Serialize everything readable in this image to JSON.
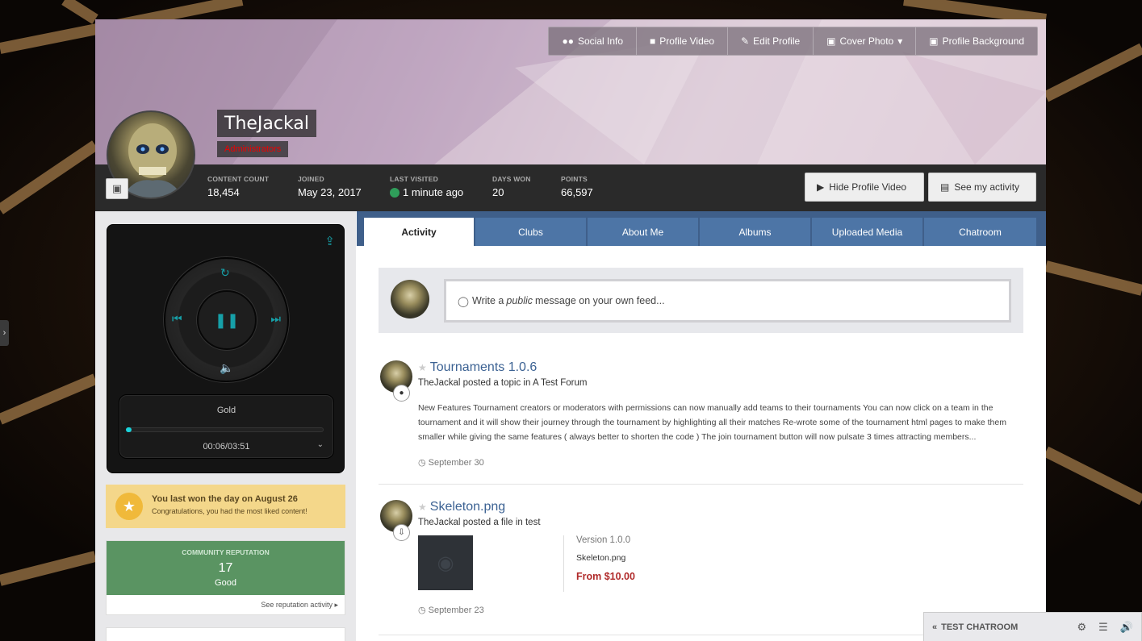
{
  "cover": {
    "buttons": [
      {
        "icon": "users-icon",
        "label": "Social Info"
      },
      {
        "icon": "video-camera-icon",
        "label": "Profile Video"
      },
      {
        "icon": "pencil-icon",
        "label": "Edit Profile"
      },
      {
        "icon": "image-icon",
        "label": "Cover Photo"
      },
      {
        "icon": "image-icon",
        "label": "Profile Background"
      }
    ]
  },
  "profile": {
    "name": "TheJackal",
    "role": "Administrators",
    "role_color": "#ee0000"
  },
  "stats": {
    "content_count_label": "Content Count",
    "content_count": "18,454",
    "joined_label": "Joined",
    "joined": "May 23, 2017",
    "last_visited_label": "Last Visited",
    "last_visited": "1 minute ago",
    "days_won_label": "Days Won",
    "days_won": "20",
    "points_label": "Points",
    "points": "66,597",
    "hide_video_label": "Hide Profile Video",
    "see_activity_label": "See my activity"
  },
  "player": {
    "track_name": "Gold",
    "time": "00:06/03:51",
    "progress": 0.03,
    "accent": "#16a0a8"
  },
  "trophy": {
    "title": "You last won the day on August 26",
    "subtitle": "Congratulations, you had the most liked content!"
  },
  "reputation": {
    "label": "Community Reputation",
    "value": "17",
    "rating": "Good",
    "link": "See reputation activity"
  },
  "tabs": [
    {
      "label": "Activity",
      "active": true
    },
    {
      "label": "Clubs"
    },
    {
      "label": "About Me"
    },
    {
      "label": "Albums"
    },
    {
      "label": "Uploaded Media"
    },
    {
      "label": "Chatroom"
    }
  ],
  "composer": {
    "prefix": "Write a ",
    "emphasis": "public",
    "suffix": " message on your own feed..."
  },
  "feed": [
    {
      "title": "Tournaments 1.0.6",
      "author": "TheJackal",
      "action": " posted a topic in ",
      "location": "A Test Forum",
      "excerpt": "New Features Tournament creators or moderators with permissions can now manually add teams to their tournaments You can now click on a team in the tournament and it will show their journey through the tournament by highlighting all their matches Re-wrote some of the tournament html pages to make them smaller while giving the same features ( always better to shorten the code ) The join tournament button will now pulsate 3 times attracting members...",
      "date": "September 30"
    },
    {
      "title": "Skeleton.png",
      "author": "TheJackal",
      "action": " posted a file in ",
      "location": "test",
      "version": "Version 1.0.0",
      "filename": "Skeleton.png",
      "price": "From $10.00",
      "date": "September 23"
    }
  ],
  "chatbar": {
    "title": "TEST CHATROOM"
  }
}
